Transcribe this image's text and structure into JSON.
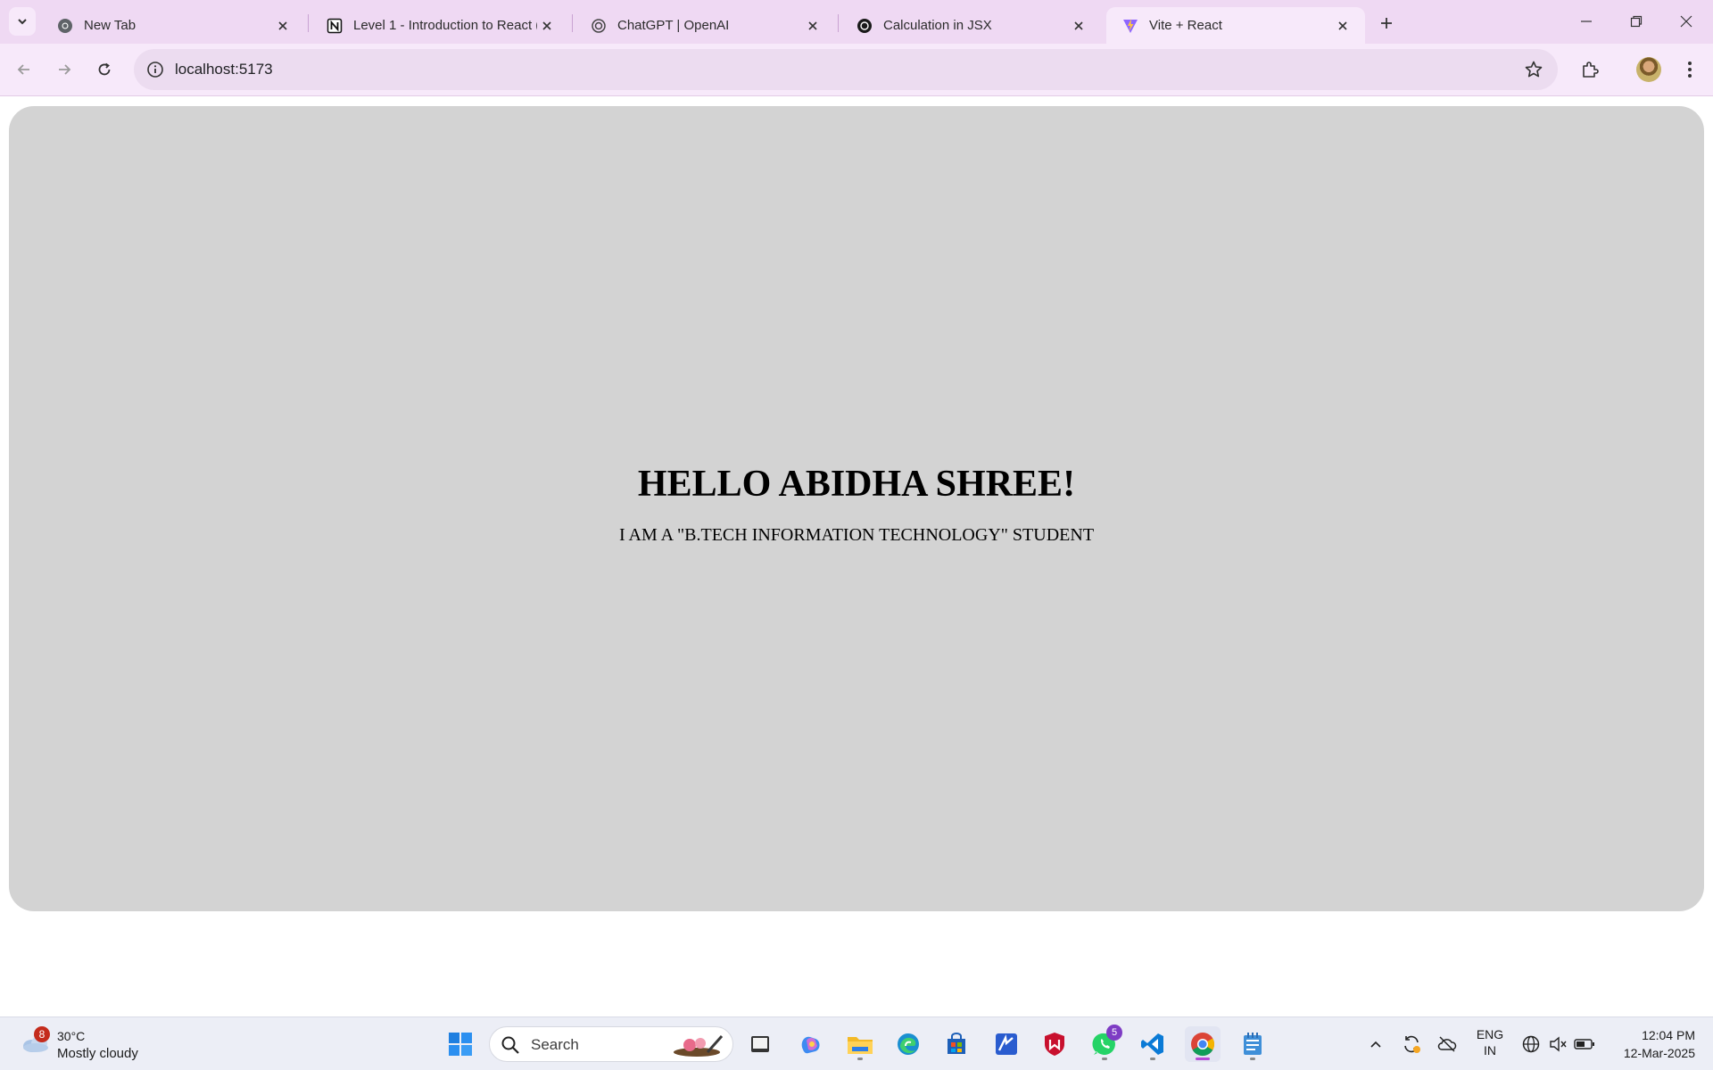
{
  "browser": {
    "tabs": [
      {
        "title": "New Tab",
        "icon": "chrome-icon",
        "active": false
      },
      {
        "title": "Level 1 - Introduction to React (",
        "icon": "notion-icon",
        "active": false
      },
      {
        "title": "ChatGPT | OpenAI",
        "icon": "openai-icon",
        "active": false
      },
      {
        "title": "Calculation in JSX",
        "icon": "openai-icon",
        "active": false
      },
      {
        "title": "Vite + React",
        "icon": "vite-icon",
        "active": true
      }
    ],
    "address": "localhost:5173"
  },
  "page": {
    "heading": "HELLO ABIDHA SHREE!",
    "subtext": "I AM A \"B.TECH INFORMATION TECHNOLOGY\" STUDENT",
    "card_color": "#d3d3d3"
  },
  "taskbar": {
    "weather": {
      "temp": "30°C",
      "condition": "Mostly cloudy",
      "badge": "8"
    },
    "search_label": "Search",
    "whatsapp_badge": "5",
    "language": {
      "line1": "ENG",
      "line2": "IN"
    },
    "time": "12:04 PM",
    "date": "12-Mar-2025"
  },
  "colors": {
    "tabstrip": "#efd9f3",
    "toolbar": "#f7e9fa",
    "accent": "#b44bd6"
  }
}
